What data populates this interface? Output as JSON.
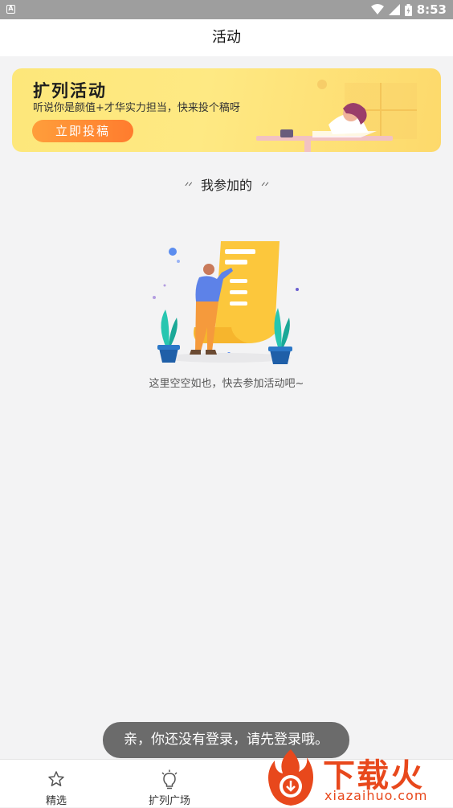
{
  "status_bar": {
    "time": "8:53"
  },
  "header": {
    "title": "活动"
  },
  "banner": {
    "title": "扩列活动",
    "subtitle": "听说你是颜值+才华实力担当，快来投个稿呀",
    "button_label": "立即投稿"
  },
  "section": {
    "title": "我参加的",
    "quote_left": "ᐟᐟ",
    "quote_right": "ᐟᐟ"
  },
  "empty_state": {
    "message": "这里空空如也，快去参加活动吧~"
  },
  "toast": {
    "message": "亲，你还没有登录，请先登录哦。"
  },
  "tab_bar": {
    "items": [
      {
        "label": "精选",
        "icon": "star-icon"
      },
      {
        "label": "扩列广场",
        "icon": "lightbulb-icon"
      }
    ]
  },
  "watermark": {
    "text": "下载火",
    "url": "xiazaihuo.com"
  },
  "colors": {
    "accent": "#ff8a33",
    "banner_bg": "#fee983",
    "toast_bg": "#6b6b6b",
    "watermark": "#e8481c"
  }
}
